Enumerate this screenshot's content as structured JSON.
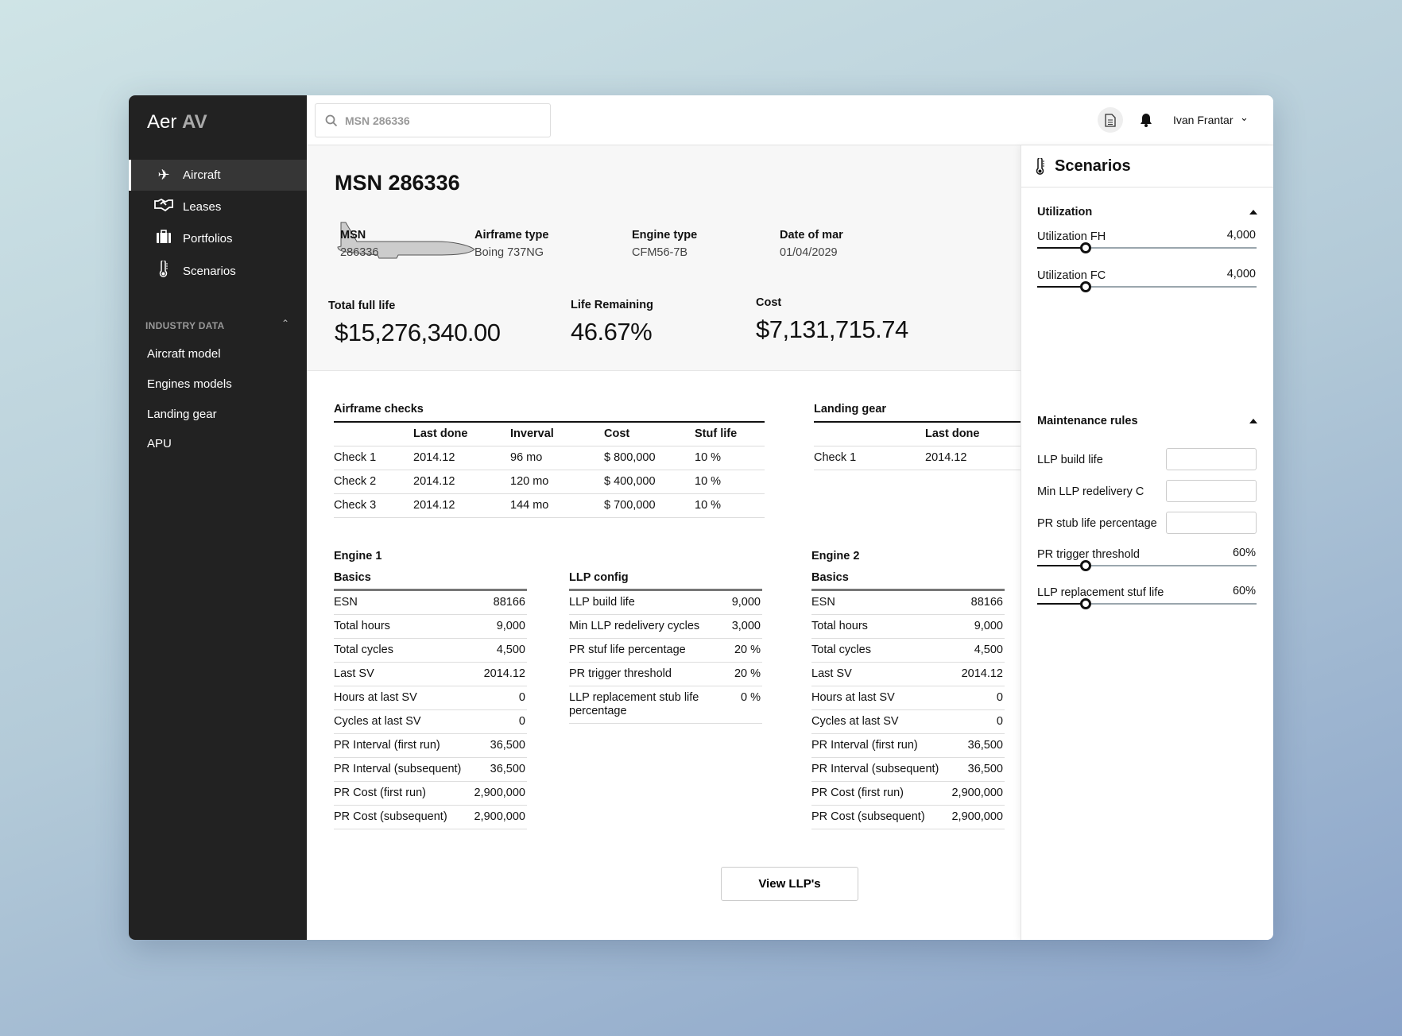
{
  "app": {
    "logo_light": "Aer",
    "logo_bold": "AV"
  },
  "sidebar": {
    "items": [
      {
        "label": "Aircraft",
        "icon": "airplane-icon",
        "active": true
      },
      {
        "label": "Leases",
        "icon": "handshake-icon"
      },
      {
        "label": "Portfolios",
        "icon": "briefcase-icon"
      },
      {
        "label": "Scenarios",
        "icon": "thermometer-icon"
      }
    ],
    "section_label": "INDUSTRY DATA",
    "sub_items": [
      "Aircraft model",
      "Engines models",
      "Landing gear",
      "APU"
    ]
  },
  "header": {
    "search_value": "MSN 286336",
    "user_name": "Ivan Frantar"
  },
  "aircraft": {
    "title": "MSN 286336",
    "info": [
      {
        "label": "MSN",
        "value": "286336"
      },
      {
        "label": "Airframe type",
        "value": "Boing 737NG"
      },
      {
        "label": "Engine type",
        "value": "CFM56-7B"
      },
      {
        "label": "Date of mar",
        "value": "01/04/2029"
      }
    ],
    "stats": [
      {
        "label": "Total full life",
        "value": "$15,276,340.00"
      },
      {
        "label": "Life Remaining",
        "value": "46.67%"
      },
      {
        "label": "Cost",
        "value": "$7,131,715.74"
      }
    ]
  },
  "airframe_checks": {
    "title": "Airframe checks",
    "columns": [
      "",
      "Last done",
      "Inverval",
      "Cost",
      "Stuf life"
    ],
    "rows": [
      [
        "Check 1",
        "2014.12",
        "96 mo",
        "$ 800,000",
        "10 %"
      ],
      [
        "Check 2",
        "2014.12",
        "120 mo",
        "$ 400,000",
        "10 %"
      ],
      [
        "Check 3",
        "2014.12",
        "144 mo",
        "$ 700,000",
        "10 %"
      ]
    ]
  },
  "landing_gear": {
    "title": "Landing gear",
    "columns": [
      "",
      "Last done"
    ],
    "rows": [
      [
        "Check 1",
        "2014.12"
      ]
    ]
  },
  "engine1": {
    "title": "Engine 1",
    "section": "Basics",
    "rows": [
      [
        "ESN",
        "88166"
      ],
      [
        "Total hours",
        "9,000"
      ],
      [
        "Total cycles",
        "4,500"
      ],
      [
        "Last SV",
        "2014.12"
      ],
      [
        "Hours at last SV",
        "0"
      ],
      [
        "Cycles at last SV",
        "0"
      ],
      [
        "PR Interval (first run)",
        "36,500"
      ],
      [
        "PR Interval (subsequent)",
        "36,500"
      ],
      [
        "PR Cost (first run)",
        "2,900,000"
      ],
      [
        "PR Cost (subsequent)",
        "2,900,000"
      ]
    ]
  },
  "llp_config": {
    "section": "LLP config",
    "rows": [
      [
        "LLP build life",
        "9,000"
      ],
      [
        "Min LLP redelivery cycles",
        "3,000"
      ],
      [
        "PR stuf life percentage",
        "20 %"
      ],
      [
        "PR trigger threshold",
        "20 %"
      ],
      [
        "LLP replacement stub life percentage",
        "0 %"
      ]
    ]
  },
  "engine2": {
    "title": "Engine 2",
    "section": "Basics",
    "rows": [
      [
        "ESN",
        "88166"
      ],
      [
        "Total hours",
        "9,000"
      ],
      [
        "Total cycles",
        "4,500"
      ],
      [
        "Last SV",
        "2014.12"
      ],
      [
        "Hours at last SV",
        "0"
      ],
      [
        "Cycles at last SV",
        "0"
      ],
      [
        "PR Interval (first run)",
        "36,500"
      ],
      [
        "PR Interval (subsequent)",
        "36,500"
      ],
      [
        "PR Cost (first run)",
        "2,900,000"
      ],
      [
        "PR Cost (subsequent)",
        "2,900,000"
      ]
    ]
  },
  "view_llps_label": "View LLP's",
  "scenarios": {
    "title": "Scenarios",
    "utilization_title": "Utilization",
    "utilization": [
      {
        "label": "Utilization FH",
        "value": "4,000",
        "fill": 0.22
      },
      {
        "label": "Utilization FC",
        "value": "4,000",
        "fill": 0.22
      }
    ],
    "maintenance_title": "Maintenance rules",
    "inputs": [
      {
        "label": "LLP build life",
        "value": ""
      },
      {
        "label": "Min LLP redelivery C",
        "value": ""
      },
      {
        "label": "PR stub life percentage",
        "value": ""
      }
    ],
    "sliders": [
      {
        "label": "PR trigger threshold",
        "value": "60%",
        "fill": 0.22
      },
      {
        "label": "LLP replacement stuf life",
        "value": "60%",
        "fill": 0.22
      }
    ]
  },
  "colors": {
    "sidebar": "#222222",
    "active_item": "#363636",
    "slider_track": "#9aa6ad",
    "accent": "#111111"
  }
}
